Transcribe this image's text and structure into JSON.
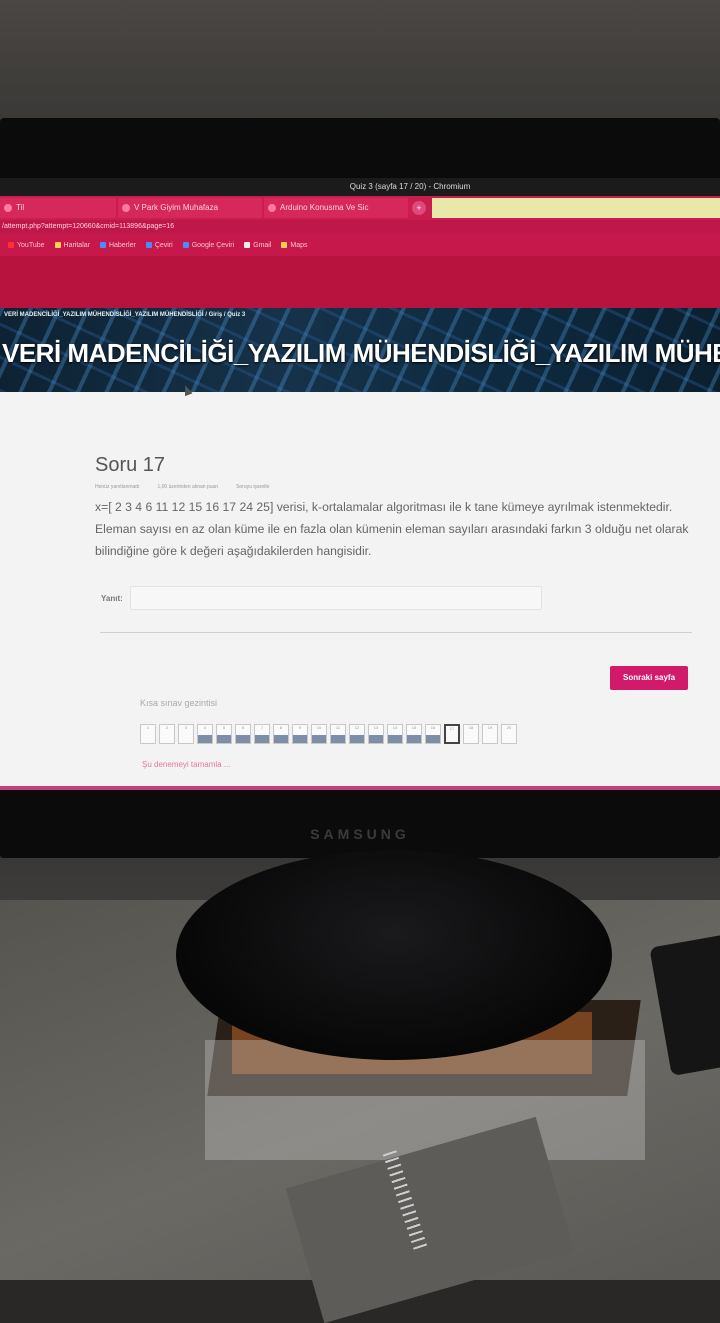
{
  "window": {
    "title": "Quiz 3 (sayfa 17 / 20) - Chromium"
  },
  "tabs": [
    {
      "label": "Til"
    },
    {
      "label": "V Park Giyim Muhafaza"
    },
    {
      "label": "Arduino Konusma Ve Sic"
    }
  ],
  "url": "/attempt.php?attempt=120660&cmid=113896&page=16",
  "bookmarks": [
    "YouTube",
    "Haritalar",
    "Haberler",
    "Çeviri",
    "Google Çeviri",
    "Gmail",
    "Maps"
  ],
  "breadcrumb": "VERİ MADENCİLİĞİ_YAZILIM MÜHENDİSLİĞİ_YAZILIM MÜHENDİSLİĞİ / Giriş / Quiz 3",
  "course_title": "VERİ MADENCİLİĞİ_YAZILIM MÜHENDİSLİĞİ_YAZILIM MÜHE",
  "question": {
    "title": "Soru 17",
    "status": "Henüz yanıtlanmadı",
    "points": "1,00 üzerinden alınan puan",
    "flag": "Soruyu işaretle",
    "text": "x=[ 2 3 4 6 11 12 15 16 17 24 25] verisi, k-ortalamalar algoritması ile k tane kümeye ayrılmak istenmektedir. Eleman sayısı en az olan küme ile en fazla olan kümenin eleman sayıları arasındaki farkın 3 olduğu net olarak bilindiğine göre k değeri aşağıdakilerden hangisidir.",
    "answer_label": "Yanıt:",
    "answer_value": ""
  },
  "next_button": "Sonraki sayfa",
  "quiz_nav": {
    "title": "Kısa sınav gezintisi",
    "cells": [
      {
        "n": "1",
        "state": "empty"
      },
      {
        "n": "2",
        "state": "empty"
      },
      {
        "n": "3",
        "state": "empty"
      },
      {
        "n": "4",
        "state": "answered"
      },
      {
        "n": "5",
        "state": "answered"
      },
      {
        "n": "6",
        "state": "answered"
      },
      {
        "n": "7",
        "state": "answered"
      },
      {
        "n": "8",
        "state": "answered"
      },
      {
        "n": "9",
        "state": "answered"
      },
      {
        "n": "10",
        "state": "answered"
      },
      {
        "n": "11",
        "state": "answered"
      },
      {
        "n": "12",
        "state": "answered"
      },
      {
        "n": "13",
        "state": "answered"
      },
      {
        "n": "14",
        "state": "answered"
      },
      {
        "n": "15",
        "state": "answered"
      },
      {
        "n": "16",
        "state": "answered"
      },
      {
        "n": "17",
        "state": "current"
      },
      {
        "n": "18",
        "state": "empty"
      },
      {
        "n": "19",
        "state": "empty"
      },
      {
        "n": "20",
        "state": "empty"
      }
    ],
    "finish_link": "Şu denemeyi tamamla ..."
  },
  "monitor_brand": "SAMSUNG",
  "colors": {
    "browser_accent": "#c91d4e",
    "button": "#d11a6a",
    "hero": "#16324a"
  }
}
